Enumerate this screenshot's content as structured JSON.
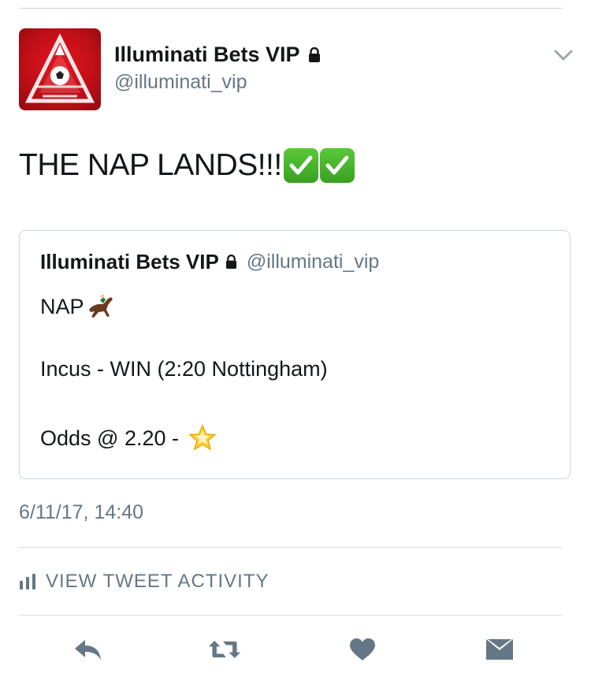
{
  "author": {
    "display_name": "Illuminati Bets VIP",
    "handle": "@illuminati_vip",
    "avatar_icon": "illuminati-pyramid-football-logo",
    "protected_icon": "lock-icon"
  },
  "tweet": {
    "text": "THE NAP LANDS!!!",
    "emoji": [
      "check-mark-button",
      "check-mark-button"
    ]
  },
  "quoted_tweet": {
    "display_name": "Illuminati Bets VIP",
    "handle": "@illuminati_vip",
    "line1": "NAP",
    "line1_emoji": "horse-racing",
    "line2": "Incus - WIN (2:20 Nottingham)",
    "line3": "Odds @ 2.20 -",
    "line3_emoji": "glowing-star"
  },
  "timestamp": "6/11/17, 14:40",
  "activity": {
    "label": "VIEW TWEET ACTIVITY",
    "icon": "bar-chart-icon"
  },
  "actions": [
    {
      "name": "reply",
      "icon": "reply-icon"
    },
    {
      "name": "retweet",
      "icon": "retweet-icon"
    },
    {
      "name": "like",
      "icon": "heart-icon"
    },
    {
      "name": "share",
      "icon": "envelope-icon"
    }
  ],
  "colors": {
    "text": "#14171a",
    "secondary": "#657786",
    "icon": "#657786",
    "avatar_red": "#d0121b",
    "check_green": "#4cb830",
    "border": "#ccd6dd"
  }
}
